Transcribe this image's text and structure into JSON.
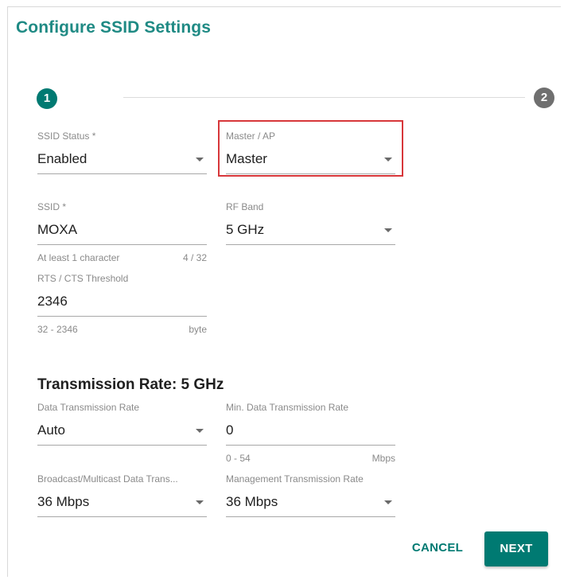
{
  "dialog": {
    "title": "Configure SSID Settings"
  },
  "stepper": {
    "step1": "1",
    "step2": "2"
  },
  "fields": {
    "ssid_status": {
      "label": "SSID Status *",
      "value": "Enabled"
    },
    "master_ap": {
      "label": "Master / AP",
      "value": "Master"
    },
    "ssid": {
      "label": "SSID *",
      "value": "MOXA",
      "hint": "At least 1 character",
      "counter": "4 / 32"
    },
    "rf_band": {
      "label": "RF Band",
      "value": "5 GHz"
    },
    "rts_cts": {
      "label": "RTS / CTS Threshold",
      "value": "2346",
      "hint": "32 - 2346",
      "unit": "byte"
    },
    "data_tx_rate": {
      "label": "Data Transmission Rate",
      "value": "Auto"
    },
    "min_data_tx_rate": {
      "label": "Min. Data Transmission Rate",
      "value": "0",
      "hint": "0 - 54",
      "unit": "Mbps"
    },
    "broadcast_rate": {
      "label": "Broadcast/Multicast Data Trans...",
      "value": "36 Mbps"
    },
    "mgmt_rate": {
      "label": "Management Transmission Rate",
      "value": "36 Mbps"
    }
  },
  "section": {
    "transmission_title": "Transmission Rate: 5 GHz"
  },
  "buttons": {
    "cancel": "CANCEL",
    "next": "NEXT"
  },
  "colors": {
    "accent": "#007a72",
    "title": "#1f8a84",
    "highlight": "#d7373a"
  }
}
